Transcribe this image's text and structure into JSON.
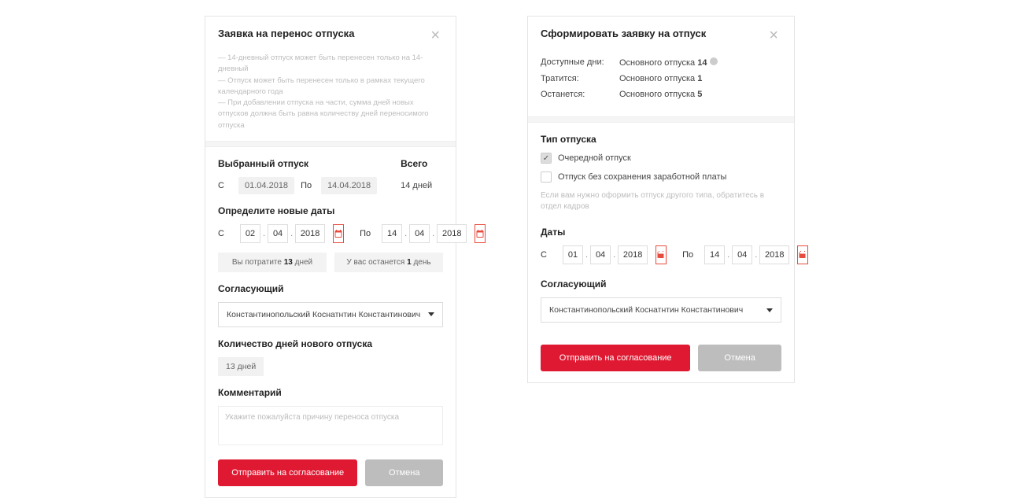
{
  "left": {
    "title": "Заявка на перенос отпуска",
    "notes": [
      "14-дневный отпуск может быть перенесен только на 14-дневный",
      "Отпуск может быть перенесен только в рамках текущего календарного года",
      "При добавлении отпуска на части, сумма дней новых отпусков должна быть равна количеству дней переносимого отпуска"
    ],
    "selected": {
      "label": "Выбранный отпуск",
      "from_label": "С",
      "from": "01.04.2018",
      "to_label": "По",
      "to": "14.04.2018",
      "total_label": "Всего",
      "total": "14 дней"
    },
    "new_dates": {
      "label": "Определите новые даты",
      "from_label": "С",
      "from_d": "02",
      "from_m": "04",
      "from_y": "2018",
      "to_label": "По",
      "to_d": "14",
      "to_m": "04",
      "to_y": "2018",
      "spend_prefix": "Вы потратите",
      "spend_n": "13",
      "spend_suffix": "дней",
      "remain_prefix": "У вас останется",
      "remain_n": "1",
      "remain_suffix": "день"
    },
    "approver": {
      "label": "Согласующий",
      "name": "Константинопольский Коснатнтин Константинович"
    },
    "days_count": {
      "label": "Количество дней нового отпуска",
      "value": "13 дней"
    },
    "comment": {
      "label": "Комментарий",
      "placeholder": "Укажите пожалуйста причину переноса отпуска"
    },
    "buttons": {
      "submit": "Отправить на согласование",
      "cancel": "Отмена"
    }
  },
  "right": {
    "title": "Сформировать заявку на отпуск",
    "info": {
      "available_label": "Доступные дни:",
      "available_value": "Основного отпуска",
      "available_n": "14",
      "spend_label": "Тратится:",
      "spend_value": "Основного отпуска",
      "spend_n": "1",
      "remain_label": "Останется:",
      "remain_value": "Основного отпуска",
      "remain_n": "5"
    },
    "type": {
      "label": "Тип отпуска",
      "opt1": "Очередной отпуск",
      "opt2": "Отпуск без сохранения заработной платы",
      "helper": "Если вам нужно оформить отпуск другого типа, обратитесь в отдел кадров"
    },
    "dates": {
      "label": "Даты",
      "from_label": "С",
      "from_d": "01",
      "from_m": "04",
      "from_y": "2018",
      "to_label": "По",
      "to_d": "14",
      "to_m": "04",
      "to_y": "2018"
    },
    "approver": {
      "label": "Согласующий",
      "name": "Константинопольский Коснатнтин Константинович"
    },
    "buttons": {
      "submit": "Отправить на согласование",
      "cancel": "Отмена"
    }
  }
}
